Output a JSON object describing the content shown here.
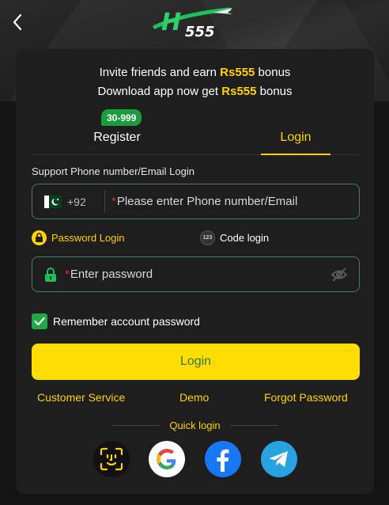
{
  "header": {
    "brand": "H555"
  },
  "promo": {
    "line1_prefix": "Invite friends and earn ",
    "line1_highlight": "Rs555",
    "line1_suffix": " bonus",
    "line2_prefix": "Download app now get ",
    "line2_highlight": "Rs555",
    "line2_suffix": " bonus"
  },
  "tabs": {
    "register": "Register",
    "register_badge": "30-999",
    "login": "Login",
    "active": "login"
  },
  "form": {
    "phone_label": "Support Phone number/Email Login",
    "country_code": "+92",
    "phone_placeholder": "Please enter Phone number/Email",
    "required_mark": "*",
    "password_mode_label": "Password Login",
    "code_mode_label": "Code login",
    "code_mode_icon_text": "123",
    "password_placeholder": "Enter password",
    "remember_label": "Remember account password",
    "remember_checked": true,
    "login_button": "Login"
  },
  "links": {
    "customer_service": "Customer Service",
    "demo": "Demo",
    "forgot_password": "Forgot Password"
  },
  "quick_login": {
    "label": "Quick login",
    "providers": [
      "face-id",
      "google",
      "facebook",
      "telegram"
    ]
  },
  "colors": {
    "accent": "#ffd400",
    "button": "#ffdd00",
    "button_text": "#2f7a44",
    "input_border": "#3f7f67",
    "badge": "#1c9c3c",
    "checkbox": "#22a844",
    "facebook": "#1877f2",
    "telegram": "#29a3df"
  }
}
